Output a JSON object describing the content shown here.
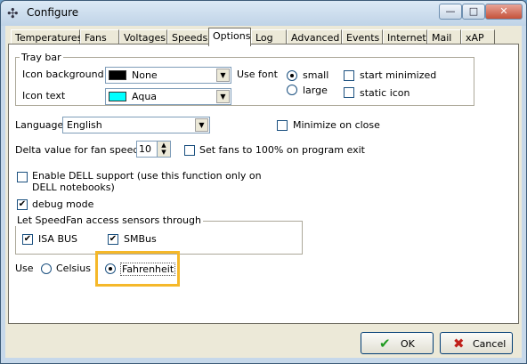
{
  "window": {
    "title": "Configure",
    "app_icon": "speedfan-icon",
    "controls": {
      "minimize": "—",
      "maximize": "□",
      "close": "✕"
    }
  },
  "tabs": [
    "Temperatures",
    "Fans",
    "Voltages",
    "Speeds",
    "Options",
    "Log",
    "Advanced",
    "Events",
    "Internet",
    "Mail",
    "xAP"
  ],
  "active_tab": "Options",
  "traybar": {
    "group_label": "Tray bar",
    "icon_background_label": "Icon background",
    "icon_background_value": "None",
    "icon_background_color": "#000000",
    "icon_text_label": "Icon text",
    "icon_text_value": "Aqua",
    "icon_text_color": "#00ffff",
    "use_font_label": "Use font",
    "font_small": "small",
    "font_large": "large",
    "font_selected": "small",
    "start_minimized": "start minimized",
    "start_minimized_checked": false,
    "static_icon": "static icon",
    "static_icon_checked": false
  },
  "language": {
    "label": "Language",
    "value": "English"
  },
  "minimize_on_close": {
    "label": "Minimize on close",
    "checked": false
  },
  "delta": {
    "label": "Delta value for fan speeds",
    "value": "10"
  },
  "fans_100": {
    "label": "Set fans to 100% on program exit",
    "checked": false
  },
  "dell": {
    "line1": "Enable DELL support (use this function only on",
    "line2": "DELL notebooks)",
    "checked": false
  },
  "debug": {
    "label": "debug mode",
    "checked": true
  },
  "sensors": {
    "group_label": "Let SpeedFan access sensors through",
    "isa_label": "ISA BUS",
    "isa_checked": true,
    "smbus_label": "SMBus",
    "smbus_checked": true
  },
  "units": {
    "use_label": "Use",
    "celsius": "Celsius",
    "fahrenheit": "Fahrenheit",
    "selected": "Fahrenheit"
  },
  "highlight_color": "#f5b82a",
  "buttons": {
    "ok": "OK",
    "cancel": "Cancel",
    "ok_icon": "✔",
    "cancel_icon": "✖"
  }
}
